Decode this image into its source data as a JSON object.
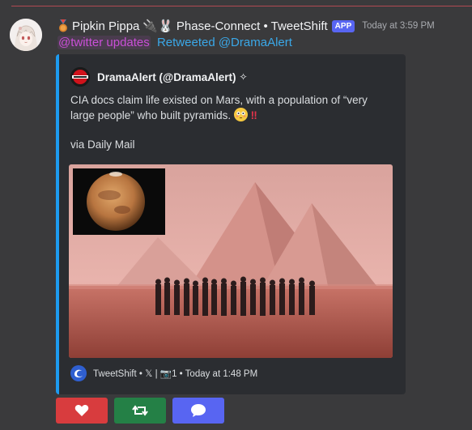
{
  "message": {
    "author": "Pipkin Pippa",
    "author_suffix": "🔌🐰 Phase-Connect • TweetShift",
    "app_badge": "APP",
    "timestamp": "Today at 3:59 PM",
    "mention": "@twitter updates",
    "retweet_text": "Retweeted @DramaAlert"
  },
  "embed": {
    "accent_color": "#1d9bf0",
    "author_name": "DramaAlert (@DramaAlert)",
    "author_mark": "✧",
    "description_line1": "CIA docs claim life existed on Mars, with a population of “very large people” who built pyramids.",
    "description_line2": "via Daily Mail",
    "footer": "TweetShift • 𝕏 | 📷1 • Today at 1:48 PM"
  },
  "actions": {
    "like_icon": "heart-icon",
    "retweet_icon": "retweet-icon",
    "reply_icon": "speech-bubble-icon"
  }
}
